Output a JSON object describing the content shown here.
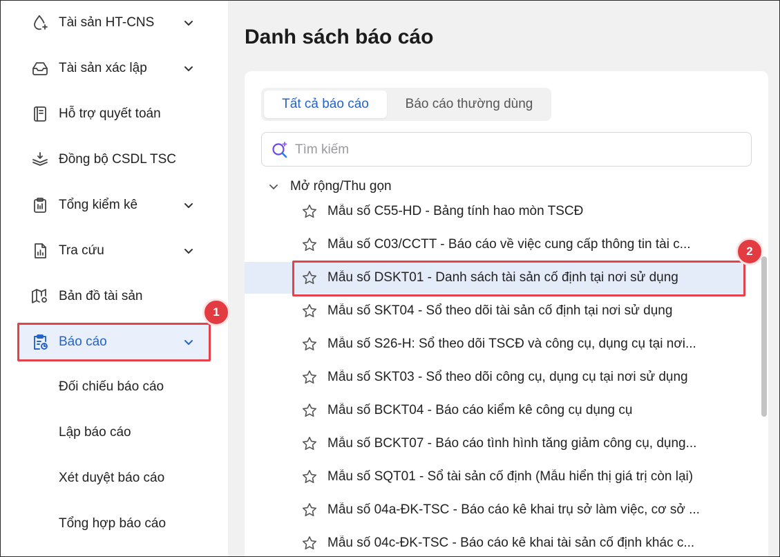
{
  "sidebar": {
    "items": [
      {
        "label": "Tài sản HT-CNS",
        "icon": "droplet-plus-icon",
        "has_chevron": true
      },
      {
        "label": "Tài sản xác lập",
        "icon": "inbox-icon",
        "has_chevron": true
      },
      {
        "label": "Hỗ trợ quyết toán",
        "icon": "notebook-icon",
        "has_chevron": false
      },
      {
        "label": "Đồng bộ CSDL TSC",
        "icon": "layers-sync-icon",
        "has_chevron": false
      },
      {
        "label": "Tổng kiểm kê",
        "icon": "clipboard-icon",
        "has_chevron": true
      },
      {
        "label": "Tra cứu",
        "icon": "report-chart-icon",
        "has_chevron": true
      },
      {
        "label": "Bản đồ tài sản",
        "icon": "map-pin-icon",
        "has_chevron": false
      },
      {
        "label": "Báo cáo",
        "icon": "clipboard-clock-icon",
        "has_chevron": true,
        "active": true
      }
    ],
    "sub_items": [
      "Đối chiếu báo cáo",
      "Lập báo cáo",
      "Xét duyệt báo cáo",
      "Tổng hợp báo cáo"
    ]
  },
  "badges": {
    "one": "1",
    "two": "2"
  },
  "main": {
    "title": "Danh sách báo cáo",
    "tabs": [
      {
        "label": "Tất cả báo cáo",
        "active": true
      },
      {
        "label": "Báo cáo thường dùng",
        "active": false
      }
    ],
    "search": {
      "placeholder": "Tìm kiếm",
      "value": ""
    },
    "tree_toggle": "Mở rộng/Thu gọn",
    "reports": [
      "Mẫu số C55-HD - Bảng tính hao mòn TSCĐ",
      "Mẫu số C03/CCTT - Báo cáo về việc cung cấp thông tin tài c...",
      "Mẫu số DSKT01 - Danh sách tài sản cố định tại nơi sử dụng",
      "Mẫu số SKT04 - Sổ theo dõi tài sản cố định tại nơi sử dụng",
      "Mẫu số S26-H: Sổ theo dõi TSCĐ và công cụ, dụng cụ tại nơi...",
      "Mẫu số SKT03 - Sổ theo dõi công cụ, dụng cụ tại nơi sử dụng",
      "Mẫu số BCKT04 - Báo cáo kiểm kê công cụ dụng cụ",
      "Mẫu số BCKT07 - Báo cáo tình hình tăng giảm công cụ, dụng...",
      "Mẫu số SQT01 - Sổ tài sản cố định (Mẫu hiển thị giá trị còn lại)",
      "Mẫu số 04a-ĐK-TSC - Báo cáo kê khai trụ sở làm việc, cơ sở ...",
      "Mẫu số 04c-ĐK-TSC - Báo cáo kê khai tài sản cố định khác c..."
    ],
    "selected_report_index": 2
  },
  "colors": {
    "accent": "#2563c9",
    "highlight_red": "#e5414a",
    "selected_row": "#e4ecf9",
    "main_bg": "#f1f1f2"
  }
}
